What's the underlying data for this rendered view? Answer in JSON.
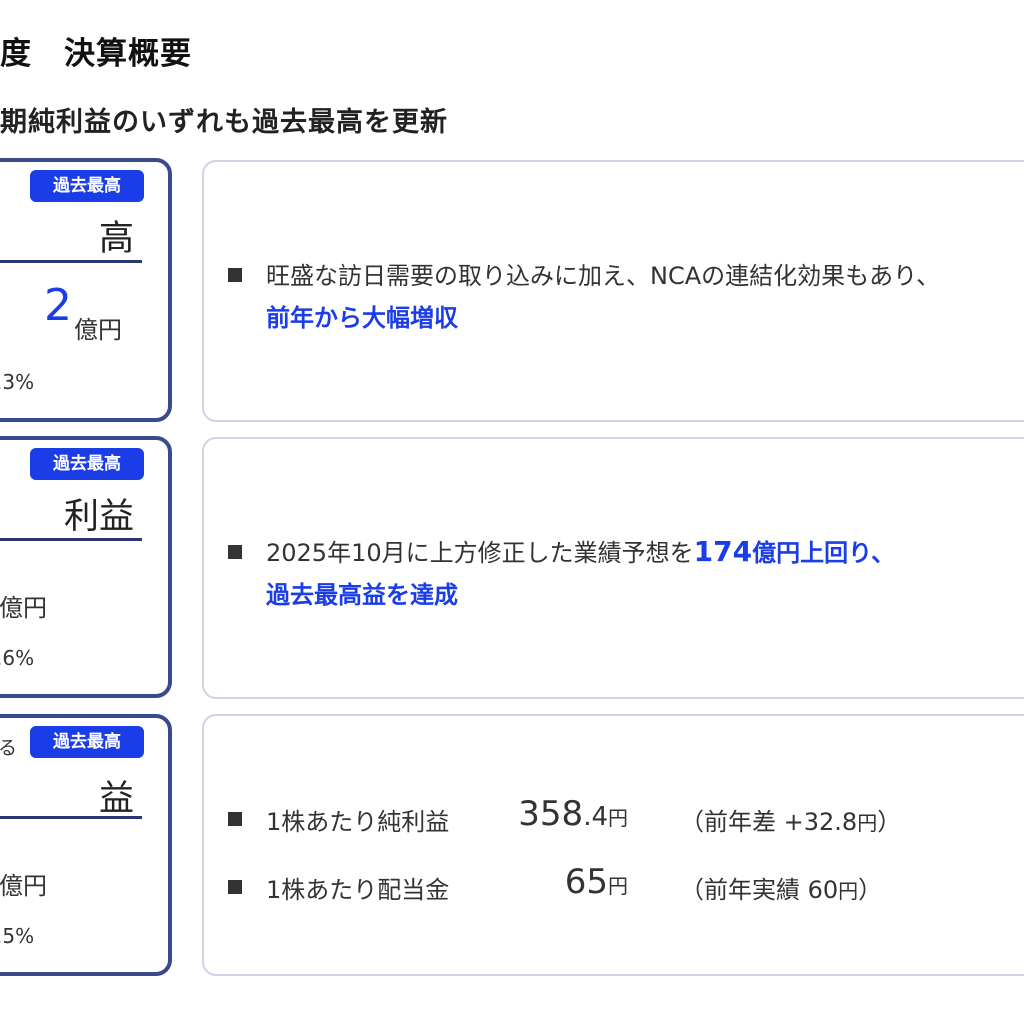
{
  "header": {
    "title": "度　決算概要",
    "subtitle": "期純利益のいずれも過去最高を更新"
  },
  "cards": [
    {
      "badge": "過去最高",
      "label": "高",
      "value": "2",
      "unit": "億円",
      "pct": ".3%"
    },
    {
      "badge": "過去最高",
      "label": "利益",
      "unit": "億円",
      "pct": ".6%"
    },
    {
      "badge": "過去最高",
      "prefix": "る",
      "label": "益",
      "unit": "億円",
      "pct": ".5%"
    }
  ],
  "panels": {
    "revenue": {
      "line1": "旺盛な訪日需要の取り込みに加え、NCAの連結化効果もあり、",
      "line2": "前年から大幅増収"
    },
    "op_profit": {
      "line1_prefix": "2025年10月に上方修正した業績予想を",
      "line1_num": "174",
      "line1_suffix": "億円上回り、",
      "line2": "過去最高益を達成"
    },
    "net_income": {
      "rows": [
        {
          "label": "1株あたり純利益",
          "value_int": "358",
          "value_dec": ".4",
          "value_unit": "円",
          "note_prefix": "（前年差 +32.8",
          "note_unit": "円",
          "note_suffix": "）"
        },
        {
          "label": "1株あたり配当金",
          "value_int": "65",
          "value_dec": "",
          "value_unit": "円",
          "note_prefix": "（前年実績 60",
          "note_unit": "円",
          "note_suffix": "）"
        }
      ]
    }
  },
  "colors": {
    "accent_blue": "#1a3de8",
    "card_border": "#3a4a8c",
    "panel_border": "#cdd4e6"
  }
}
